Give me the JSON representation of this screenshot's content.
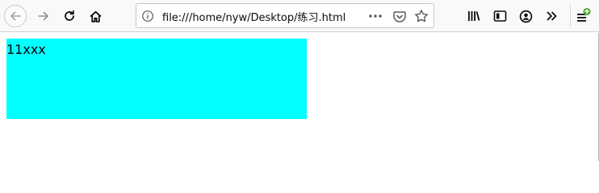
{
  "browser": {
    "url": "file:///home/nyw/Desktop/练习.html",
    "icons": [
      "back-icon",
      "forward-icon",
      "reload-icon",
      "home-icon",
      "info-icon",
      "page-actions-icon",
      "pocket-icon",
      "bookmark-star-icon",
      "library-icon",
      "sidebar-icon",
      "account-icon",
      "overflow-icon",
      "menu-update-icon"
    ]
  },
  "page": {
    "box_text": "11xxx",
    "box_color": "#00ffff"
  }
}
